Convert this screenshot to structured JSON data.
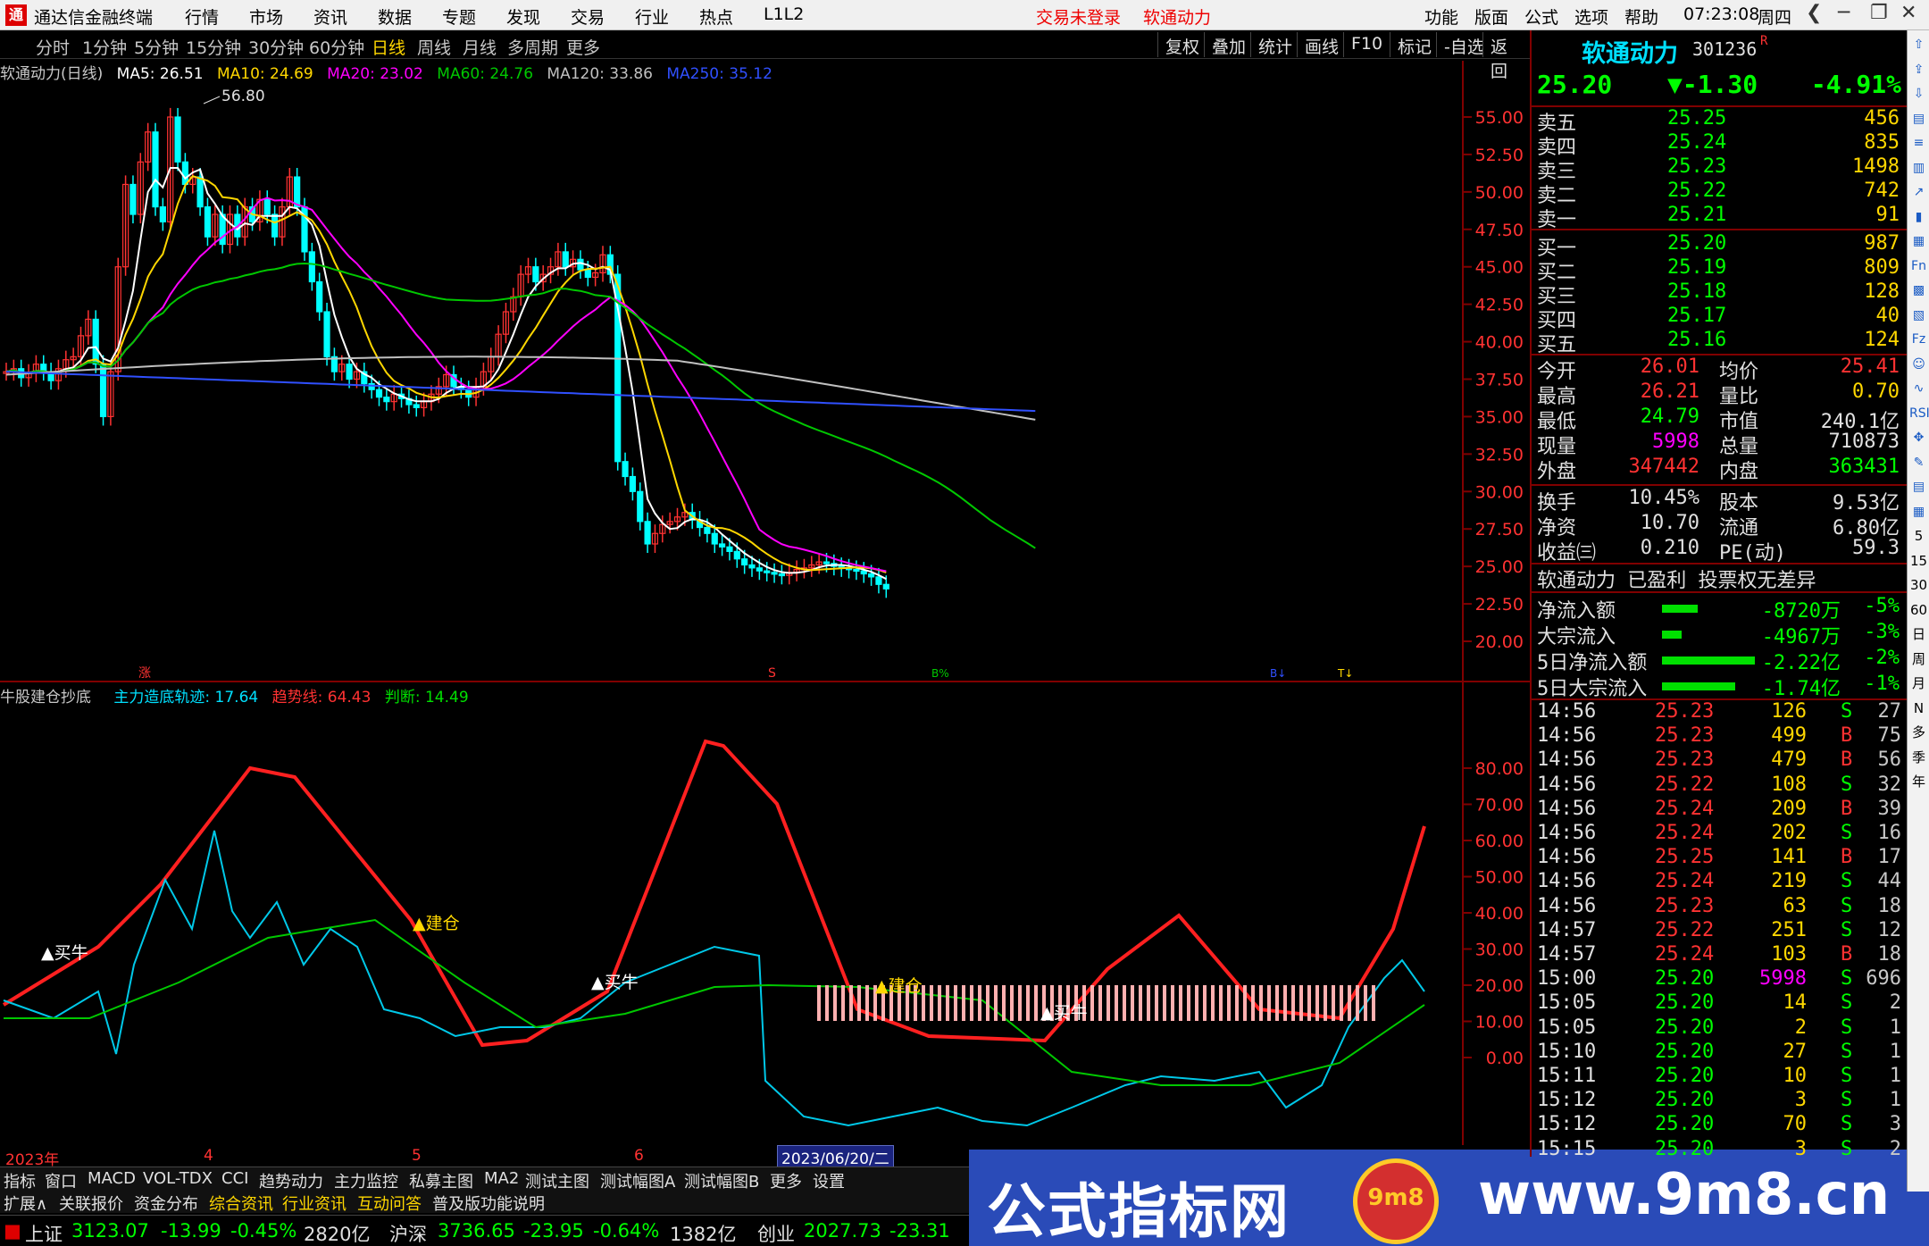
{
  "titlebar": {
    "logo": "通",
    "title": "通达信金融终端",
    "menus": [
      "行情",
      "市场",
      "资讯",
      "数据",
      "专题",
      "发现",
      "交易",
      "行业",
      "热点",
      "L1L2"
    ],
    "alert_login": "交易未登录",
    "alert_stock": "软通动力",
    "right_menus": [
      "功能",
      "版面",
      "公式",
      "选项",
      "帮助"
    ],
    "time": "07:23:08",
    "weekday": "周四",
    "win_back": "❮",
    "win_min": "─",
    "win_max": "❐",
    "win_close": "✕"
  },
  "periods": [
    "分时",
    "1分钟",
    "5分钟",
    "15分钟",
    "30分钟",
    "60分钟",
    "日线",
    "周线",
    "月线",
    "多周期",
    "更多"
  ],
  "toolbar": [
    "复权",
    "叠加",
    "统计",
    "画线",
    "F10",
    "标记",
    "-自选",
    "返回"
  ],
  "main_legend": {
    "title": "软通动力(日线)",
    "ma5": "MA5: 26.51",
    "ma10": "MA10: 24.69",
    "ma20": "MA20: 23.02",
    "ma60": "MA60: 24.76",
    "ma120": "MA120: 33.86",
    "ma250": "MA250: 35.12",
    "high_mark": "56.80",
    "low_mark_s": "S",
    "zhang": "涨",
    "bq": "B%",
    "b2": "B↓",
    "r": "T↓"
  },
  "colors": {
    "up": "#ff3232",
    "down": "#00ffff",
    "ma5": "#ffffff",
    "ma10": "#ffd700",
    "ma20": "#ff00ff",
    "ma60": "#00c800",
    "ma120": "#c0c0c0",
    "ma250": "#3050ff",
    "axis": "#800000"
  },
  "price_axis": [
    "55.00",
    "52.50",
    "50.00",
    "47.50",
    "45.00",
    "42.50",
    "40.00",
    "37.50",
    "35.00",
    "32.50",
    "30.00",
    "27.50",
    "25.00",
    "22.50",
    "20.00"
  ],
  "sub_legend": {
    "title": "牛股建仓抄底",
    "line1": "主力造底轨迹: 17.64",
    "line2": "趋势线: 64.43",
    "line3": "判断: 14.49",
    "labels": [
      "▲买牛",
      "▲建仓",
      "▲买牛",
      "▲建仓",
      "▲买牛"
    ]
  },
  "sub_axis": [
    "80.00",
    "70.00",
    "60.00",
    "50.00",
    "40.00",
    "30.00",
    "20.00",
    "10.00",
    "0.00"
  ],
  "time_axis": [
    "2023年",
    "4",
    "5",
    "6",
    "2023/06/20/二"
  ],
  "quote": {
    "name": "软通动力",
    "code": "301236",
    "code_flag": "R",
    "price": "25.20",
    "change": "▼-1.30",
    "pct": "-4.91%",
    "asks": [
      [
        "卖五",
        "25.25",
        "456"
      ],
      [
        "卖四",
        "25.24",
        "835"
      ],
      [
        "卖三",
        "25.23",
        "1498"
      ],
      [
        "卖二",
        "25.22",
        "742"
      ],
      [
        "卖一",
        "25.21",
        "91"
      ]
    ],
    "bids": [
      [
        "买一",
        "25.20",
        "987"
      ],
      [
        "买二",
        "25.19",
        "809"
      ],
      [
        "买三",
        "25.18",
        "128"
      ],
      [
        "买四",
        "25.17",
        "40"
      ],
      [
        "买五",
        "25.16",
        "124"
      ]
    ],
    "stats": [
      [
        "今开",
        "26.01",
        "均价",
        "25.41"
      ],
      [
        "最高",
        "26.21",
        "量比",
        "0.70"
      ],
      [
        "最低",
        "24.79",
        "市值",
        "240.1亿"
      ],
      [
        "现量",
        "5998",
        "总量",
        "710873"
      ],
      [
        "外盘",
        "347442",
        "内盘",
        "363431"
      ]
    ],
    "stats2": [
      [
        "换手",
        "10.45%",
        "股本",
        "9.53亿"
      ],
      [
        "净资",
        "10.70",
        "流通",
        "6.80亿"
      ],
      [
        "收益㈢",
        "0.210",
        "PE(动)",
        "59.3"
      ]
    ],
    "tagline": "软通动力 已盈利 投票权无差异",
    "flows": [
      [
        "净流入额",
        "-8720万",
        "-5%"
      ],
      [
        "大宗流入",
        "-4967万",
        "-3%"
      ],
      [
        "5日净流入额",
        "-2.22亿",
        "-2%"
      ],
      [
        "5日大宗流入",
        "-1.74亿",
        "-1%"
      ]
    ],
    "ticks": [
      [
        "14:56",
        "25.23",
        "126",
        "S",
        "27"
      ],
      [
        "14:56",
        "25.23",
        "499",
        "B",
        "75"
      ],
      [
        "14:56",
        "25.23",
        "479",
        "B",
        "56"
      ],
      [
        "14:56",
        "25.22",
        "108",
        "S",
        "32"
      ],
      [
        "14:56",
        "25.24",
        "209",
        "B",
        "39"
      ],
      [
        "14:56",
        "25.24",
        "202",
        "S",
        "16"
      ],
      [
        "14:56",
        "25.25",
        "141",
        "B",
        "17"
      ],
      [
        "14:56",
        "25.24",
        "219",
        "S",
        "44"
      ],
      [
        "14:56",
        "25.23",
        "63",
        "S",
        "18"
      ],
      [
        "14:57",
        "25.22",
        "251",
        "S",
        "12"
      ],
      [
        "14:57",
        "25.24",
        "103",
        "B",
        "18"
      ],
      [
        "15:00",
        "25.20",
        "5998",
        "S",
        "696"
      ],
      [
        "15:05",
        "25.20",
        "14",
        "S",
        "2"
      ],
      [
        "15:05",
        "25.20",
        "2",
        "S",
        "1"
      ],
      [
        "15:10",
        "25.20",
        "27",
        "S",
        "1"
      ],
      [
        "15:11",
        "25.20",
        "10",
        "S",
        "1"
      ],
      [
        "15:12",
        "25.20",
        "3",
        "S",
        "1"
      ],
      [
        "15:12",
        "25.20",
        "70",
        "S",
        "3"
      ],
      [
        "15:15",
        "25.20",
        "3",
        "S",
        "2"
      ]
    ]
  },
  "side_tools": [
    "⇧",
    "⇪",
    "⇩",
    "▤",
    "≡",
    "▥",
    "↗",
    "▮",
    "▦",
    "Fn",
    "▩",
    "▧",
    "Fz",
    "☺",
    "∿",
    "RSI",
    "✥",
    "✎",
    "▤",
    "▦",
    "5",
    "15",
    "30",
    "60",
    "日",
    "周",
    "月",
    "N",
    "多",
    "季",
    "年"
  ],
  "bottom_tabs": [
    "指标",
    "窗口",
    "MACD",
    "VOL-TDX",
    "CCI",
    "趋势动力",
    "主力监控",
    "私募主图",
    "MA2",
    "测试主图",
    "测试幅图A",
    "测试幅图B",
    "更多",
    "设置"
  ],
  "bottom_tabs2": [
    "扩展∧",
    "关联报价",
    "资金分布",
    "综合资讯",
    "行业资讯",
    "互动问答",
    "普及版功能说明"
  ],
  "status": [
    [
      "上证",
      "3123.07",
      "-13.99",
      "-0.45%",
      "2820亿"
    ],
    [
      "沪深",
      "3736.65",
      "-23.95",
      "-0.64%",
      "1382亿"
    ],
    [
      "创业",
      "2027.73",
      "-23.31",
      ""
    ]
  ],
  "banner": {
    "left": "公式指标网",
    "right": "www.9m8.cn",
    "logo": "9m8"
  }
}
